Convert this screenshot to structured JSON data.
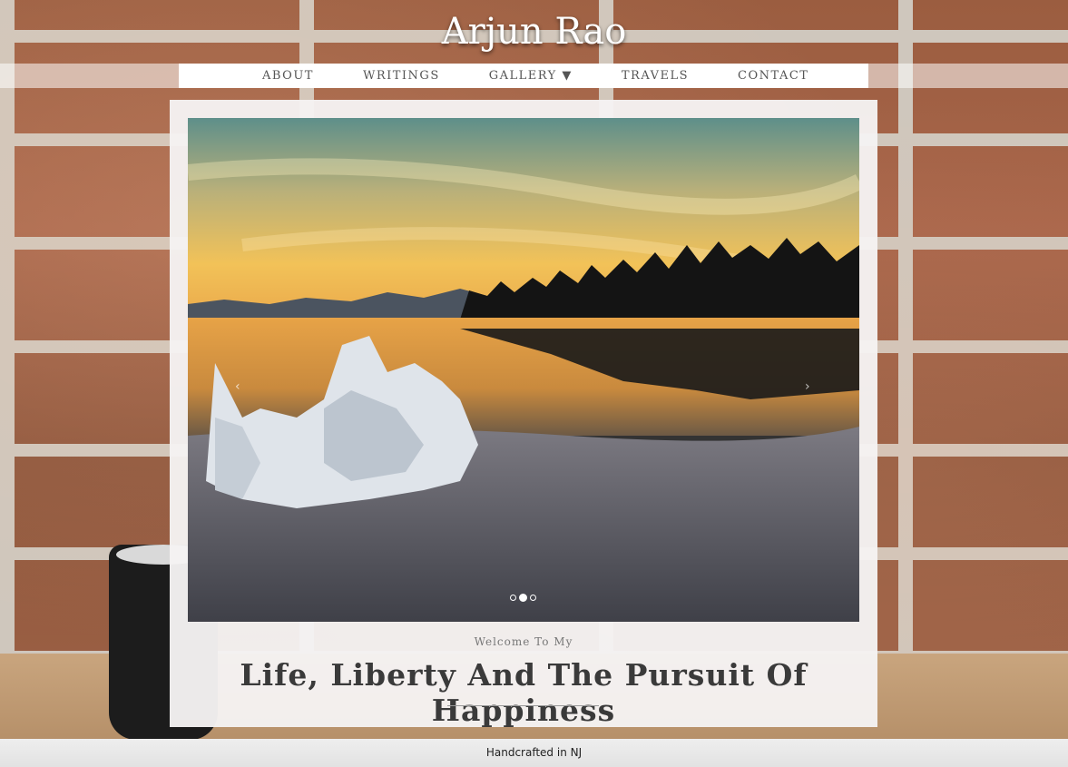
{
  "site": {
    "title": "Arjun Rao"
  },
  "nav": {
    "items": [
      "ABOUT",
      "WRITINGS",
      "GALLERY ▼",
      "TRAVELS",
      "CONTACT"
    ]
  },
  "carousel": {
    "prev_icon": "chevron-left-icon",
    "next_icon": "chevron-right-icon",
    "prev_glyph": "‹",
    "next_glyph": "›",
    "slide_count": 3,
    "active_slide": 2
  },
  "hero": {
    "welcome": "Welcome To My",
    "headline": "Life, Liberty And The Pursuit Of Happiness"
  },
  "footer": {
    "text": "Handcrafted in NJ"
  },
  "colors": {
    "card": "#f5f3f2",
    "text": "#3a3a3a",
    "nav_text": "#555555"
  }
}
